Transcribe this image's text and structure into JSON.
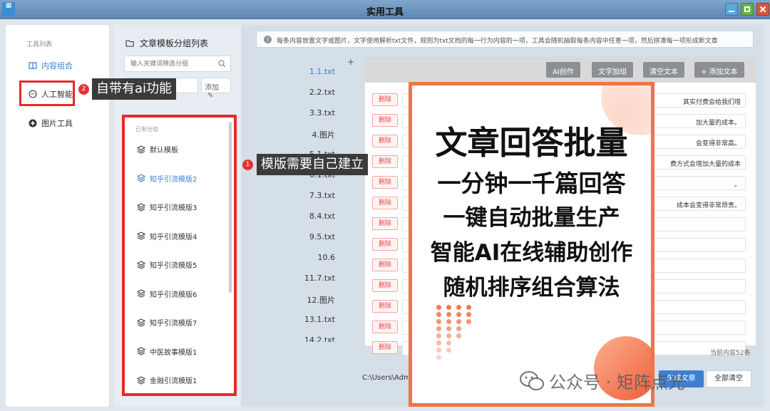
{
  "window": {
    "title": "实用工具"
  },
  "nav": {
    "heading": "工具列表",
    "items": [
      {
        "label": "内容组合",
        "icon": "book-icon",
        "active": true
      },
      {
        "label": "人工智能",
        "icon": "chat-bubble-icon",
        "active": false
      },
      {
        "label": "图片工具",
        "icon": "image-tool-icon",
        "active": false
      }
    ]
  },
  "groups": {
    "title": "文章模板分组列表",
    "search_placeholder": "输入关键词筛选分组",
    "add_label": "添加",
    "list_heading": "已有分组",
    "items": [
      {
        "label": "默认模板",
        "active": false
      },
      {
        "label": "知乎引流模版2",
        "active": true
      },
      {
        "label": "知乎引流模版3",
        "active": false
      },
      {
        "label": "知乎引流模版4",
        "active": false
      },
      {
        "label": "知乎引流模版5",
        "active": false
      },
      {
        "label": "知乎引流模版6",
        "active": false
      },
      {
        "label": "知乎引流模版7",
        "active": false
      },
      {
        "label": "中医故事模版1",
        "active": false
      },
      {
        "label": "金融引流模版1",
        "active": false
      }
    ]
  },
  "info": {
    "text": "每条内容放置文字或图片，文字使用解析txt文件，规则为txt文档的每一行为内容的一项，工具会随机抽取每条内容中任意一项，然后拼凑每一项形成新文章"
  },
  "files": {
    "items": [
      "1.1.txt",
      "2.2.txt",
      "3.3.txt",
      "4.图片",
      "5.1.txt",
      "6.1.txt",
      "7.3.txt",
      "8.4.txt",
      "9.5.txt",
      "10.6",
      "11.7.txt",
      "12.图片",
      "13.1.txt",
      "14.2.txt"
    ],
    "active_index": 0
  },
  "toolbar": {
    "ai_create": "AI创作",
    "add_text_group": "文字加组",
    "clear_text": "清空文本",
    "add_text": "+ 添加文本"
  },
  "rows": {
    "delete_label": "删除",
    "items": [
      "其实付费会给我们增",
      "加大量的成本。",
      "会变得非常高。",
      "费方式会增加大量的成本",
      "。",
      "成本会变得非常昂贵。",
      "",
      "",
      "",
      "",
      "",
      "",
      ""
    ]
  },
  "footer": {
    "count": "当前内容52条",
    "path": "C:\\Users\\Adm",
    "generate": "生成文章",
    "clear_all": "全部清空"
  },
  "callouts": {
    "ai": {
      "num": "2",
      "text": "自带有ai功能"
    },
    "template": {
      "num": "1",
      "text": "模版需要自己建立"
    }
  },
  "promo": {
    "headline": "文章回答批量",
    "lines": [
      "一分钟一千篇回答",
      "一键自动批量生产",
      "智能AI在线辅助创作",
      "随机排序组合算法"
    ]
  },
  "watermark": {
    "text": "公众号 · 矩阵点光"
  },
  "colors": {
    "accent": "#3b7fcf",
    "highlight_red": "#e62a2a",
    "promo_orange": "#f0734a"
  }
}
